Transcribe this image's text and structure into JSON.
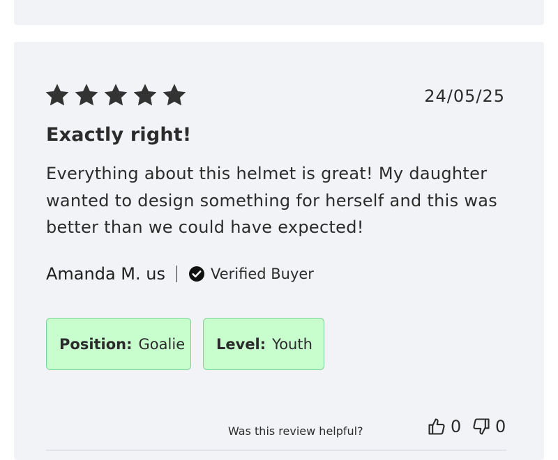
{
  "review": {
    "rating": 5,
    "rating_max": 5,
    "date": "24/05/25",
    "title": "Exactly right!",
    "body": "Everything about this helmet is great! My daughter wanted to design something for herself and this was better than we could have expected!",
    "author": "Amanda M. us",
    "verified_label": "Verified Buyer",
    "tags": [
      {
        "key": "Position:",
        "value": "Goalie"
      },
      {
        "key": "Level:",
        "value": "Youth"
      }
    ]
  },
  "helpful": {
    "question": "Was this review helpful?",
    "up_count": "0",
    "down_count": "0"
  },
  "icons": {
    "star": "star-icon",
    "verified": "check-circle-icon",
    "thumbs_up": "thumbs-up-icon",
    "thumbs_down": "thumbs-down-icon"
  },
  "colors": {
    "card_bg": "#f2f3f6",
    "tag_bg": "#c8fdcd",
    "tag_border": "#7fd49a",
    "text": "#2b2b2b"
  }
}
